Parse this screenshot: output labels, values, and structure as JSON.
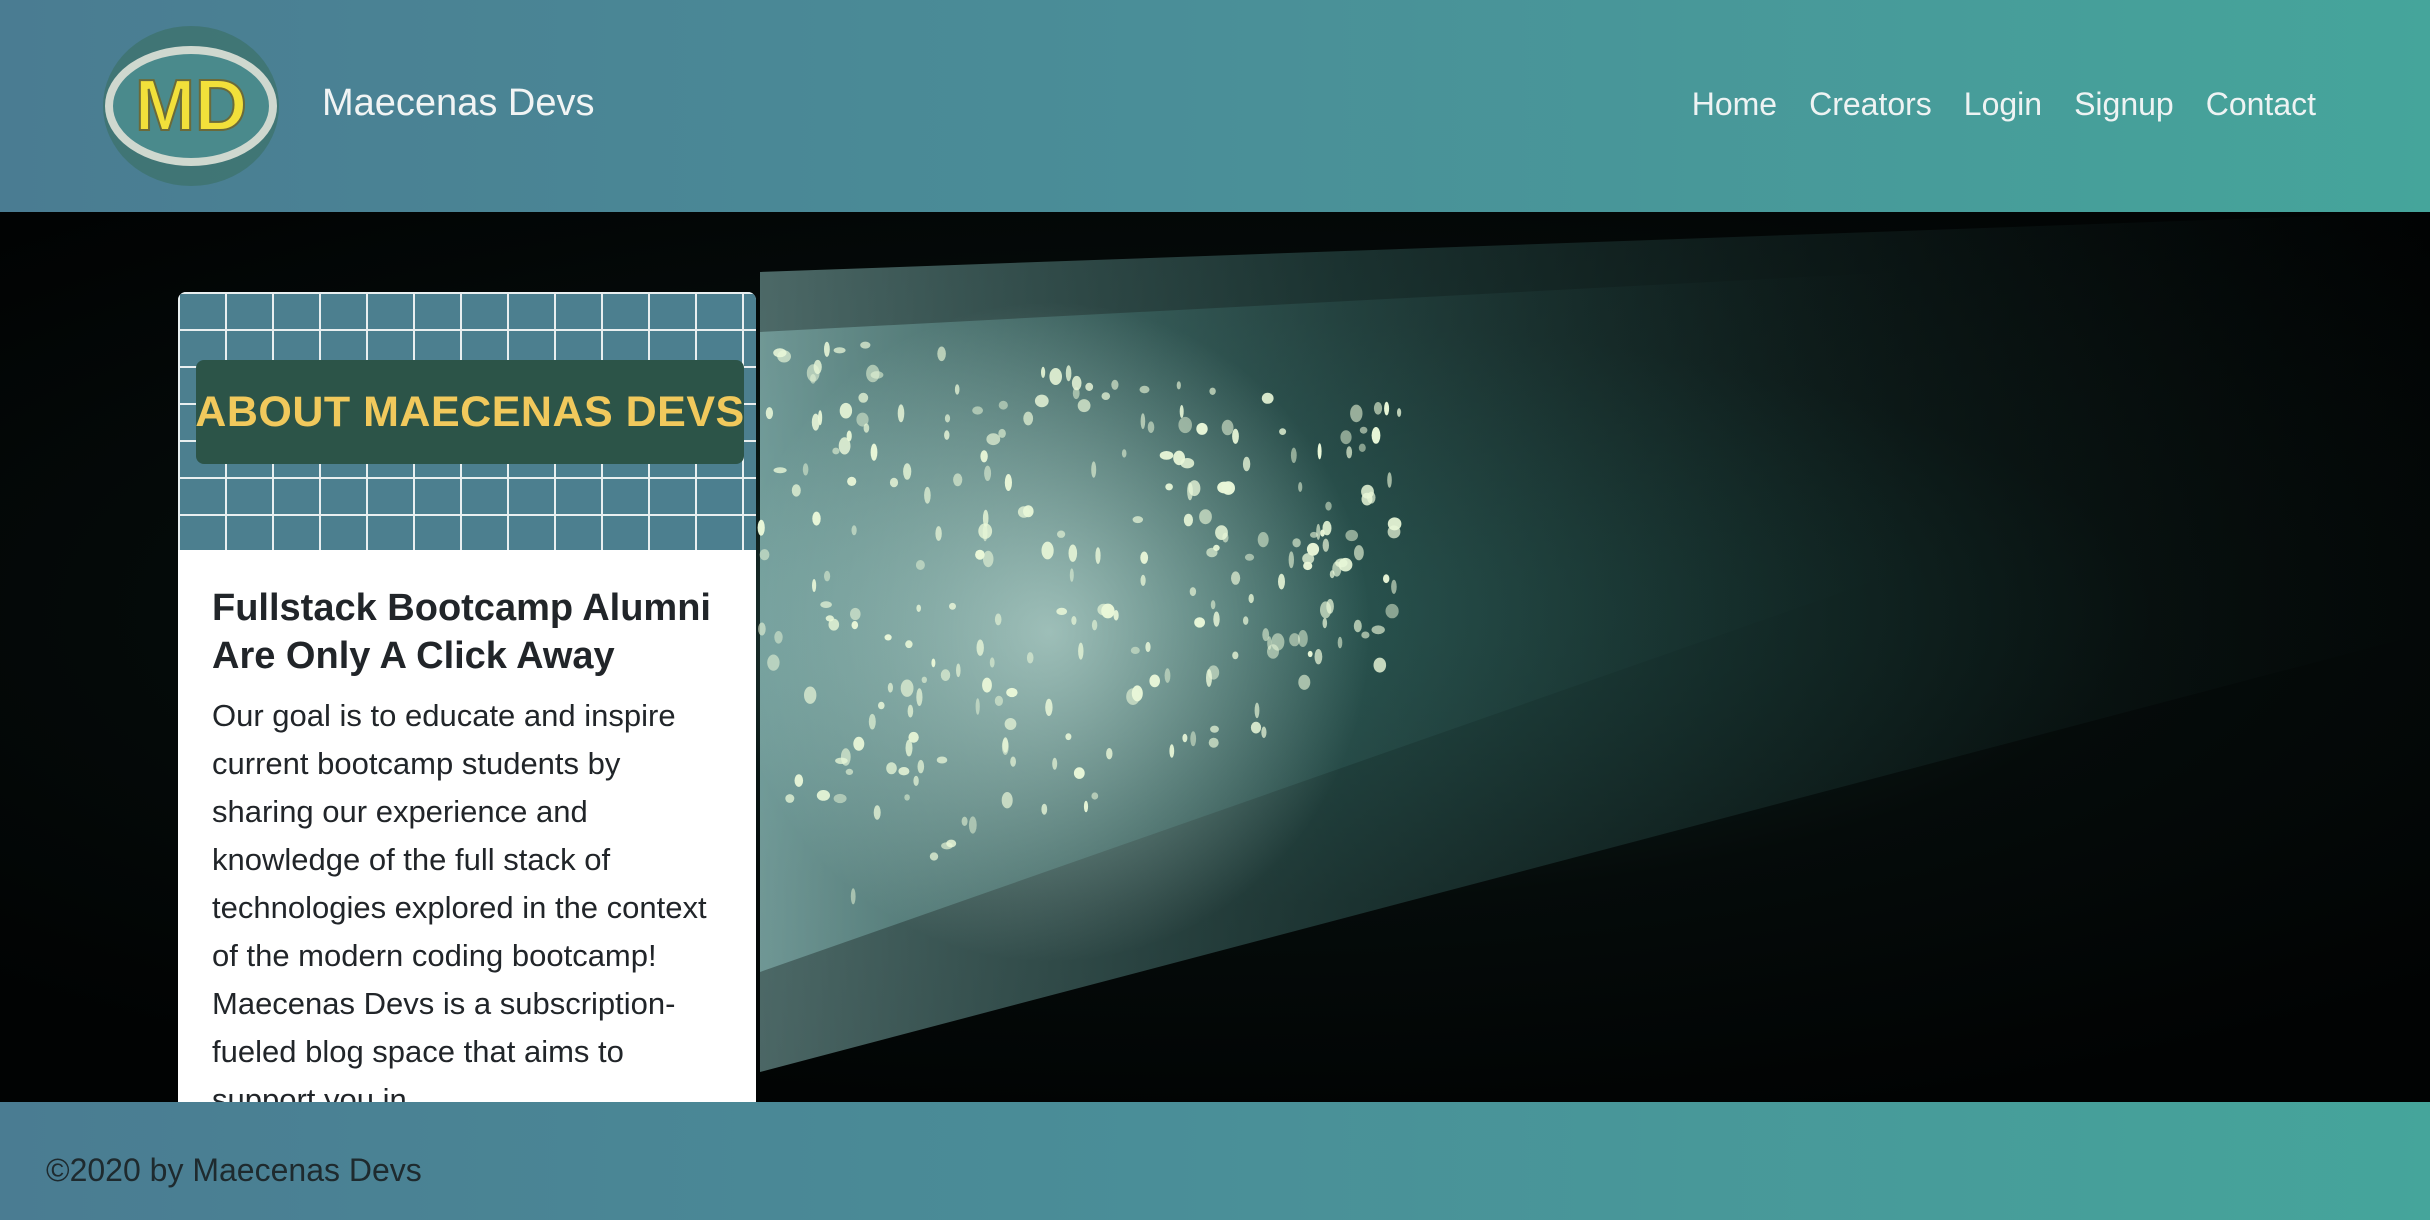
{
  "navbar": {
    "logo_text": "MD",
    "brand": "Maecenas Devs",
    "links": [
      "Home",
      "Creators",
      "Login",
      "Signup",
      "Contact"
    ]
  },
  "card": {
    "image_banner": "ABOUT MAECENAS DEVS",
    "title": "Fullstack Bootcamp Alumni Are Only A Click Away",
    "text": "Our goal is to educate and inspire current bootcamp students by sharing our experience and knowledge of the full stack of technologies explored in the context of the modern coding bootcamp! Maecenas Devs is a subscription-fueled blog space that aims to support you in"
  },
  "footer": {
    "copyright": "©2020 by Maecenas Devs"
  },
  "colors": {
    "navbar_start": "#4a7c92",
    "navbar_end": "#45a59b",
    "banner_text": "#f1c95c",
    "banner_bg": "#2c5448",
    "logo_yellow": "#f2e03a"
  }
}
